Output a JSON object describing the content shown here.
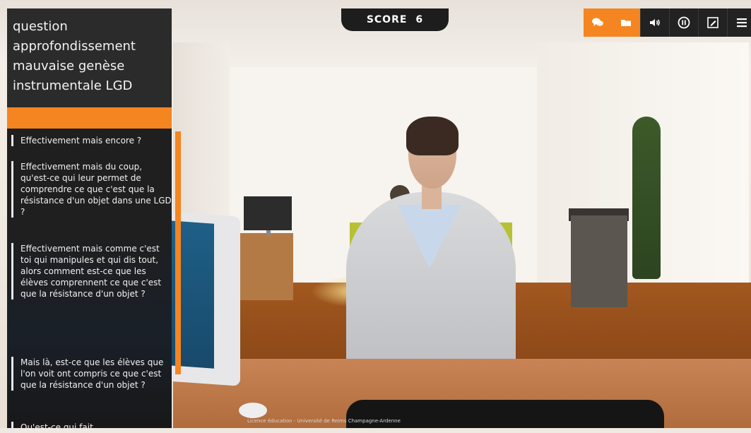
{
  "score": {
    "label": "SCORE",
    "value": "6"
  },
  "toolbar": {
    "buttons": [
      {
        "icon": "chat-icon",
        "color": "#f58520"
      },
      {
        "icon": "folder-icon",
        "color": "#f58520"
      },
      {
        "icon": "volume-icon",
        "color": "#222222"
      },
      {
        "icon": "pause-icon",
        "color": "#222222"
      },
      {
        "icon": "edit-icon",
        "color": "#222222"
      },
      {
        "icon": "menu-icon",
        "color": "#222222"
      }
    ]
  },
  "sidebar": {
    "title": "question approfondissement mauvaise genèse instrumentale LGD",
    "accent_color": "#f58520",
    "responses": [
      {
        "text": "Effectivement mais encore ?"
      },
      {
        "text": "Effectivement mais du coup, qu'est-ce qui leur permet de comprendre ce que c'est que la résistance d'un objet dans une LGD ?"
      },
      {
        "text": "Effectivement mais comme c'est toi qui manipules et qui dis tout, alors comment est-ce que les élèves comprennent ce que c'est que la résistance d'un objet ?"
      },
      {
        "text": "Mais là, est-ce que les élèves que l'on voit ont compris ce que c'est que la résistance d'un objet ?"
      },
      {
        "text": "Qu'est-ce qui fait..."
      }
    ]
  },
  "footer": {
    "text": "Licence éducation - Université de Reims Champagne-Ardenne"
  }
}
